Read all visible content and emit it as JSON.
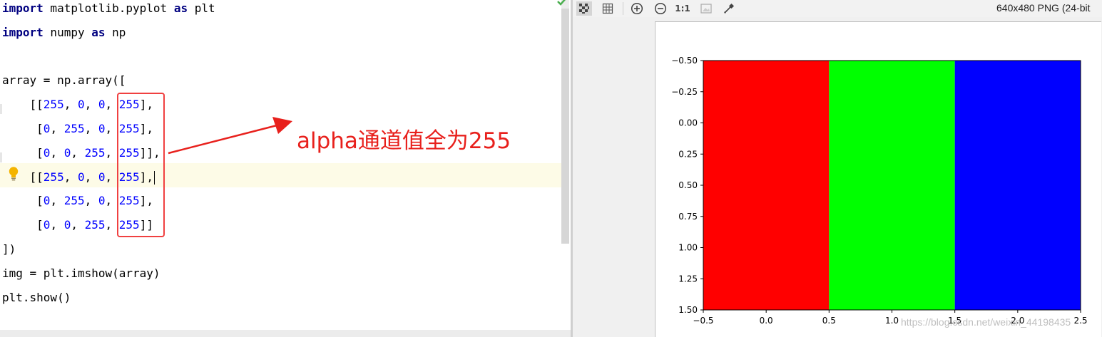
{
  "editor": {
    "lines": [
      [
        {
          "t": "import",
          "c": "kw"
        },
        {
          "t": " matplotlib.pyplot "
        },
        {
          "t": "as",
          "c": "kw"
        },
        {
          "t": " plt"
        }
      ],
      [
        {
          "t": "import",
          "c": "kw"
        },
        {
          "t": " numpy "
        },
        {
          "t": "as",
          "c": "kw"
        },
        {
          "t": " np"
        }
      ],
      [],
      [
        {
          "t": "array = np.array(["
        }
      ],
      [
        {
          "t": "    [["
        },
        {
          "t": "255",
          "c": "num"
        },
        {
          "t": ", "
        },
        {
          "t": "0",
          "c": "num"
        },
        {
          "t": ", "
        },
        {
          "t": "0",
          "c": "num"
        },
        {
          "t": ", "
        },
        {
          "t": "255",
          "c": "num"
        },
        {
          "t": "],"
        }
      ],
      [
        {
          "t": "     ["
        },
        {
          "t": "0",
          "c": "num"
        },
        {
          "t": ", "
        },
        {
          "t": "255",
          "c": "num"
        },
        {
          "t": ", "
        },
        {
          "t": "0",
          "c": "num"
        },
        {
          "t": ", "
        },
        {
          "t": "255",
          "c": "num"
        },
        {
          "t": "],"
        }
      ],
      [
        {
          "t": "     ["
        },
        {
          "t": "0",
          "c": "num"
        },
        {
          "t": ", "
        },
        {
          "t": "0",
          "c": "num"
        },
        {
          "t": ", "
        },
        {
          "t": "255",
          "c": "num"
        },
        {
          "t": ", "
        },
        {
          "t": "255",
          "c": "num"
        },
        {
          "t": "]],"
        }
      ],
      [
        {
          "t": "    [["
        },
        {
          "t": "255",
          "c": "num"
        },
        {
          "t": ", "
        },
        {
          "t": "0",
          "c": "num"
        },
        {
          "t": ", "
        },
        {
          "t": "0",
          "c": "num"
        },
        {
          "t": ", "
        },
        {
          "t": "255",
          "c": "num"
        },
        {
          "t": "],"
        }
      ],
      [
        {
          "t": "     ["
        },
        {
          "t": "0",
          "c": "num"
        },
        {
          "t": ", "
        },
        {
          "t": "255",
          "c": "num"
        },
        {
          "t": ", "
        },
        {
          "t": "0",
          "c": "num"
        },
        {
          "t": ", "
        },
        {
          "t": "255",
          "c": "num"
        },
        {
          "t": "],"
        }
      ],
      [
        {
          "t": "     ["
        },
        {
          "t": "0",
          "c": "num"
        },
        {
          "t": ", "
        },
        {
          "t": "0",
          "c": "num"
        },
        {
          "t": ", "
        },
        {
          "t": "255",
          "c": "num"
        },
        {
          "t": ", "
        },
        {
          "t": "255",
          "c": "num"
        },
        {
          "t": "]]"
        }
      ],
      [
        {
          "t": "])"
        }
      ],
      [
        {
          "t": "img = plt.imshow(array)"
        }
      ],
      [
        {
          "t": "plt.show()"
        }
      ]
    ],
    "caret_line": 7,
    "highlighted_line": 7,
    "keyword_color": "#000080",
    "number_color": "#0000ff",
    "current_line_color": "#fdfbe7"
  },
  "annotation": {
    "text": "alpha通道值全为255",
    "color": "#e8201c"
  },
  "viewer": {
    "image_info": "640x480 PNG (24-bit",
    "toolbar_icons": [
      "checkerboard-icon",
      "grid-icon",
      "zoom-in-icon",
      "zoom-out-icon",
      "actual-size-icon",
      "fit-window-icon",
      "color-picker-icon"
    ],
    "actual_size_label": "1:1",
    "watermark": "https://blog.csdn.net/weixin_44198435"
  },
  "chart_data": {
    "type": "heatmap",
    "image_rows": [
      [
        "#ff0000",
        "#00ff00",
        "#0000ff"
      ],
      [
        "#ff0000",
        "#00ff00",
        "#0000ff"
      ]
    ],
    "x_ticks": [
      -0.5,
      0.0,
      0.5,
      1.0,
      1.5,
      2.0,
      2.5
    ],
    "x_tick_labels": [
      "−0.5",
      "0.0",
      "0.5",
      "1.0",
      "1.5",
      "2.0",
      "2.5"
    ],
    "y_ticks": [
      -0.5,
      -0.25,
      0.0,
      0.25,
      0.5,
      0.75,
      1.0,
      1.25,
      1.5
    ],
    "y_tick_labels": [
      "−0.50",
      "−0.25",
      "0.00",
      "0.25",
      "0.50",
      "0.75",
      "1.00",
      "1.25",
      "1.50"
    ],
    "xlim": [
      -0.5,
      2.5
    ],
    "ylim": [
      1.5,
      -0.5
    ],
    "grid": false,
    "title": "",
    "xlabel": "",
    "ylabel": ""
  }
}
